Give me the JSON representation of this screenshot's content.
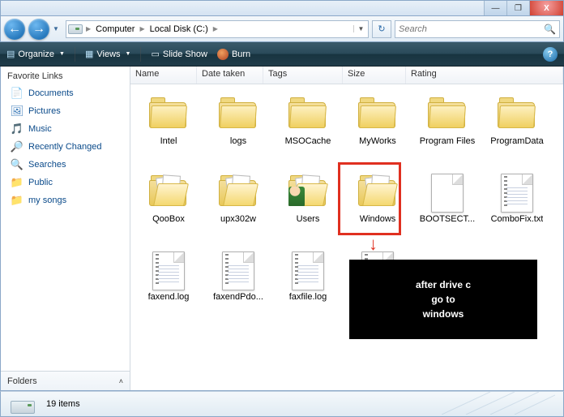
{
  "titlebar": {
    "min": "—",
    "max": "❐",
    "close": "X"
  },
  "nav": {
    "back_glyph": "←",
    "fwd_glyph": "→"
  },
  "address": {
    "segments": [
      "Computer",
      "Local Disk (C:)"
    ],
    "refresh_glyph": "↻"
  },
  "search": {
    "placeholder": "Search",
    "glass": "🔍"
  },
  "toolbar": {
    "organize": "Organize",
    "views": "Views",
    "slideshow": "Slide Show",
    "burn": "Burn"
  },
  "sidebar": {
    "header": "Favorite Links",
    "items": [
      {
        "label": "Documents",
        "icon": "📄",
        "color": "#3a8a3a"
      },
      {
        "label": "Pictures",
        "icon": "🖼",
        "color": "#3a7ab8"
      },
      {
        "label": "Music",
        "icon": "🎵",
        "color": "#2a7a9a"
      },
      {
        "label": "Recently Changed",
        "icon": "🔎",
        "color": "#3a7ab8"
      },
      {
        "label": "Searches",
        "icon": "🔍",
        "color": "#3a7ab8"
      },
      {
        "label": "Public",
        "icon": "📁",
        "color": "#d8b040"
      },
      {
        "label": "my songs",
        "icon": "📁",
        "color": "#d8b040"
      }
    ],
    "folders": "Folders"
  },
  "columns": {
    "name": "Name",
    "date": "Date taken",
    "tags": "Tags",
    "size": "Size",
    "rating": "Rating"
  },
  "items": [
    {
      "label": "Intel",
      "type": "folder"
    },
    {
      "label": "logs",
      "type": "folder"
    },
    {
      "label": "MSOCache",
      "type": "folder"
    },
    {
      "label": "MyWorks",
      "type": "folder"
    },
    {
      "label": "Program Files",
      "type": "folder"
    },
    {
      "label": "ProgramData",
      "type": "folder"
    },
    {
      "label": "QooBox",
      "type": "folder-open"
    },
    {
      "label": "upx302w",
      "type": "folder-open"
    },
    {
      "label": "Users",
      "type": "folder-users"
    },
    {
      "label": "Windows",
      "type": "folder-open",
      "highlight": true
    },
    {
      "label": "BOOTSECT...",
      "type": "file"
    },
    {
      "label": "ComboFix.txt",
      "type": "file-text"
    },
    {
      "label": "faxend.log",
      "type": "file-text"
    },
    {
      "label": "faxendPdo...",
      "type": "file-text"
    },
    {
      "label": "faxfile.log",
      "type": "file-text"
    },
    {
      "label": "",
      "type": "file-text-partial"
    }
  ],
  "annotation": {
    "line1": "after drive c",
    "line2": "go to",
    "line3": "windows"
  },
  "status": {
    "count": "19 items"
  }
}
